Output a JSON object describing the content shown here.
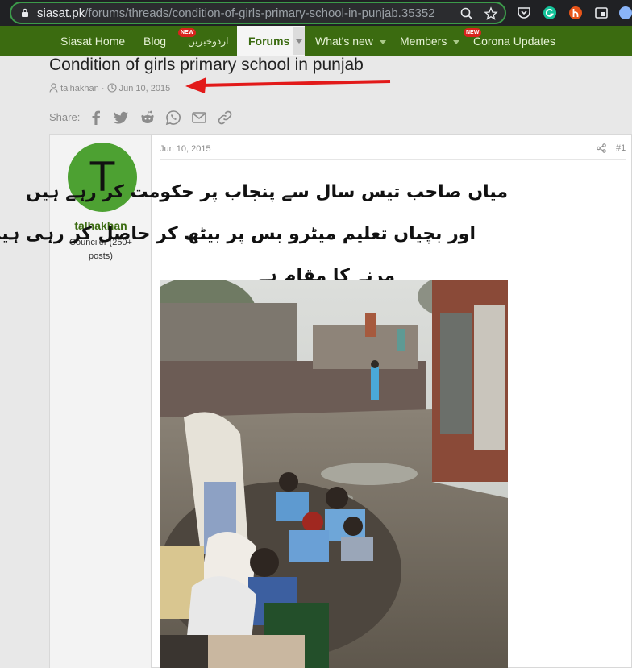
{
  "browser": {
    "url_host": "siasat.pk",
    "url_path": "/forums/threads/condition-of-girls-primary-school-in-punjab.35352"
  },
  "nav": {
    "items": [
      {
        "label": "Siasat Home"
      },
      {
        "label": "Blog"
      },
      {
        "label": "اردوخبریں",
        "badge": "NEW"
      },
      {
        "label": "Forums",
        "active": true
      },
      {
        "label": "What's new"
      },
      {
        "label": "Members"
      },
      {
        "label": "Corona Updates",
        "badge": "NEW"
      }
    ]
  },
  "thread": {
    "title": "Condition of girls primary school in punjab",
    "author": "talhakhan",
    "separator": "·",
    "date": "Jun 10, 2015",
    "share_label": "Share:"
  },
  "post": {
    "avatar_letter": "T",
    "username": "talhakhan",
    "user_title": "Counciler (250+ posts)",
    "date": "Jun 10, 2015",
    "number": "#1",
    "urdu_lines": [
      "میاں صاحب تیس سال سے پنجاب پر حکومت کر رہے ہیں",
      "اور بچیاں تعلیم میٹرو بس پر بیٹھ کر حاصل کر رہی ہیں",
      "مرنے کا مقام ہے"
    ]
  },
  "colors": {
    "nav_bg": "#3b6b10",
    "accent_green": "#3b6b10",
    "annotation_arrow": "#e21a1a",
    "badge_red": "#d9231d"
  }
}
